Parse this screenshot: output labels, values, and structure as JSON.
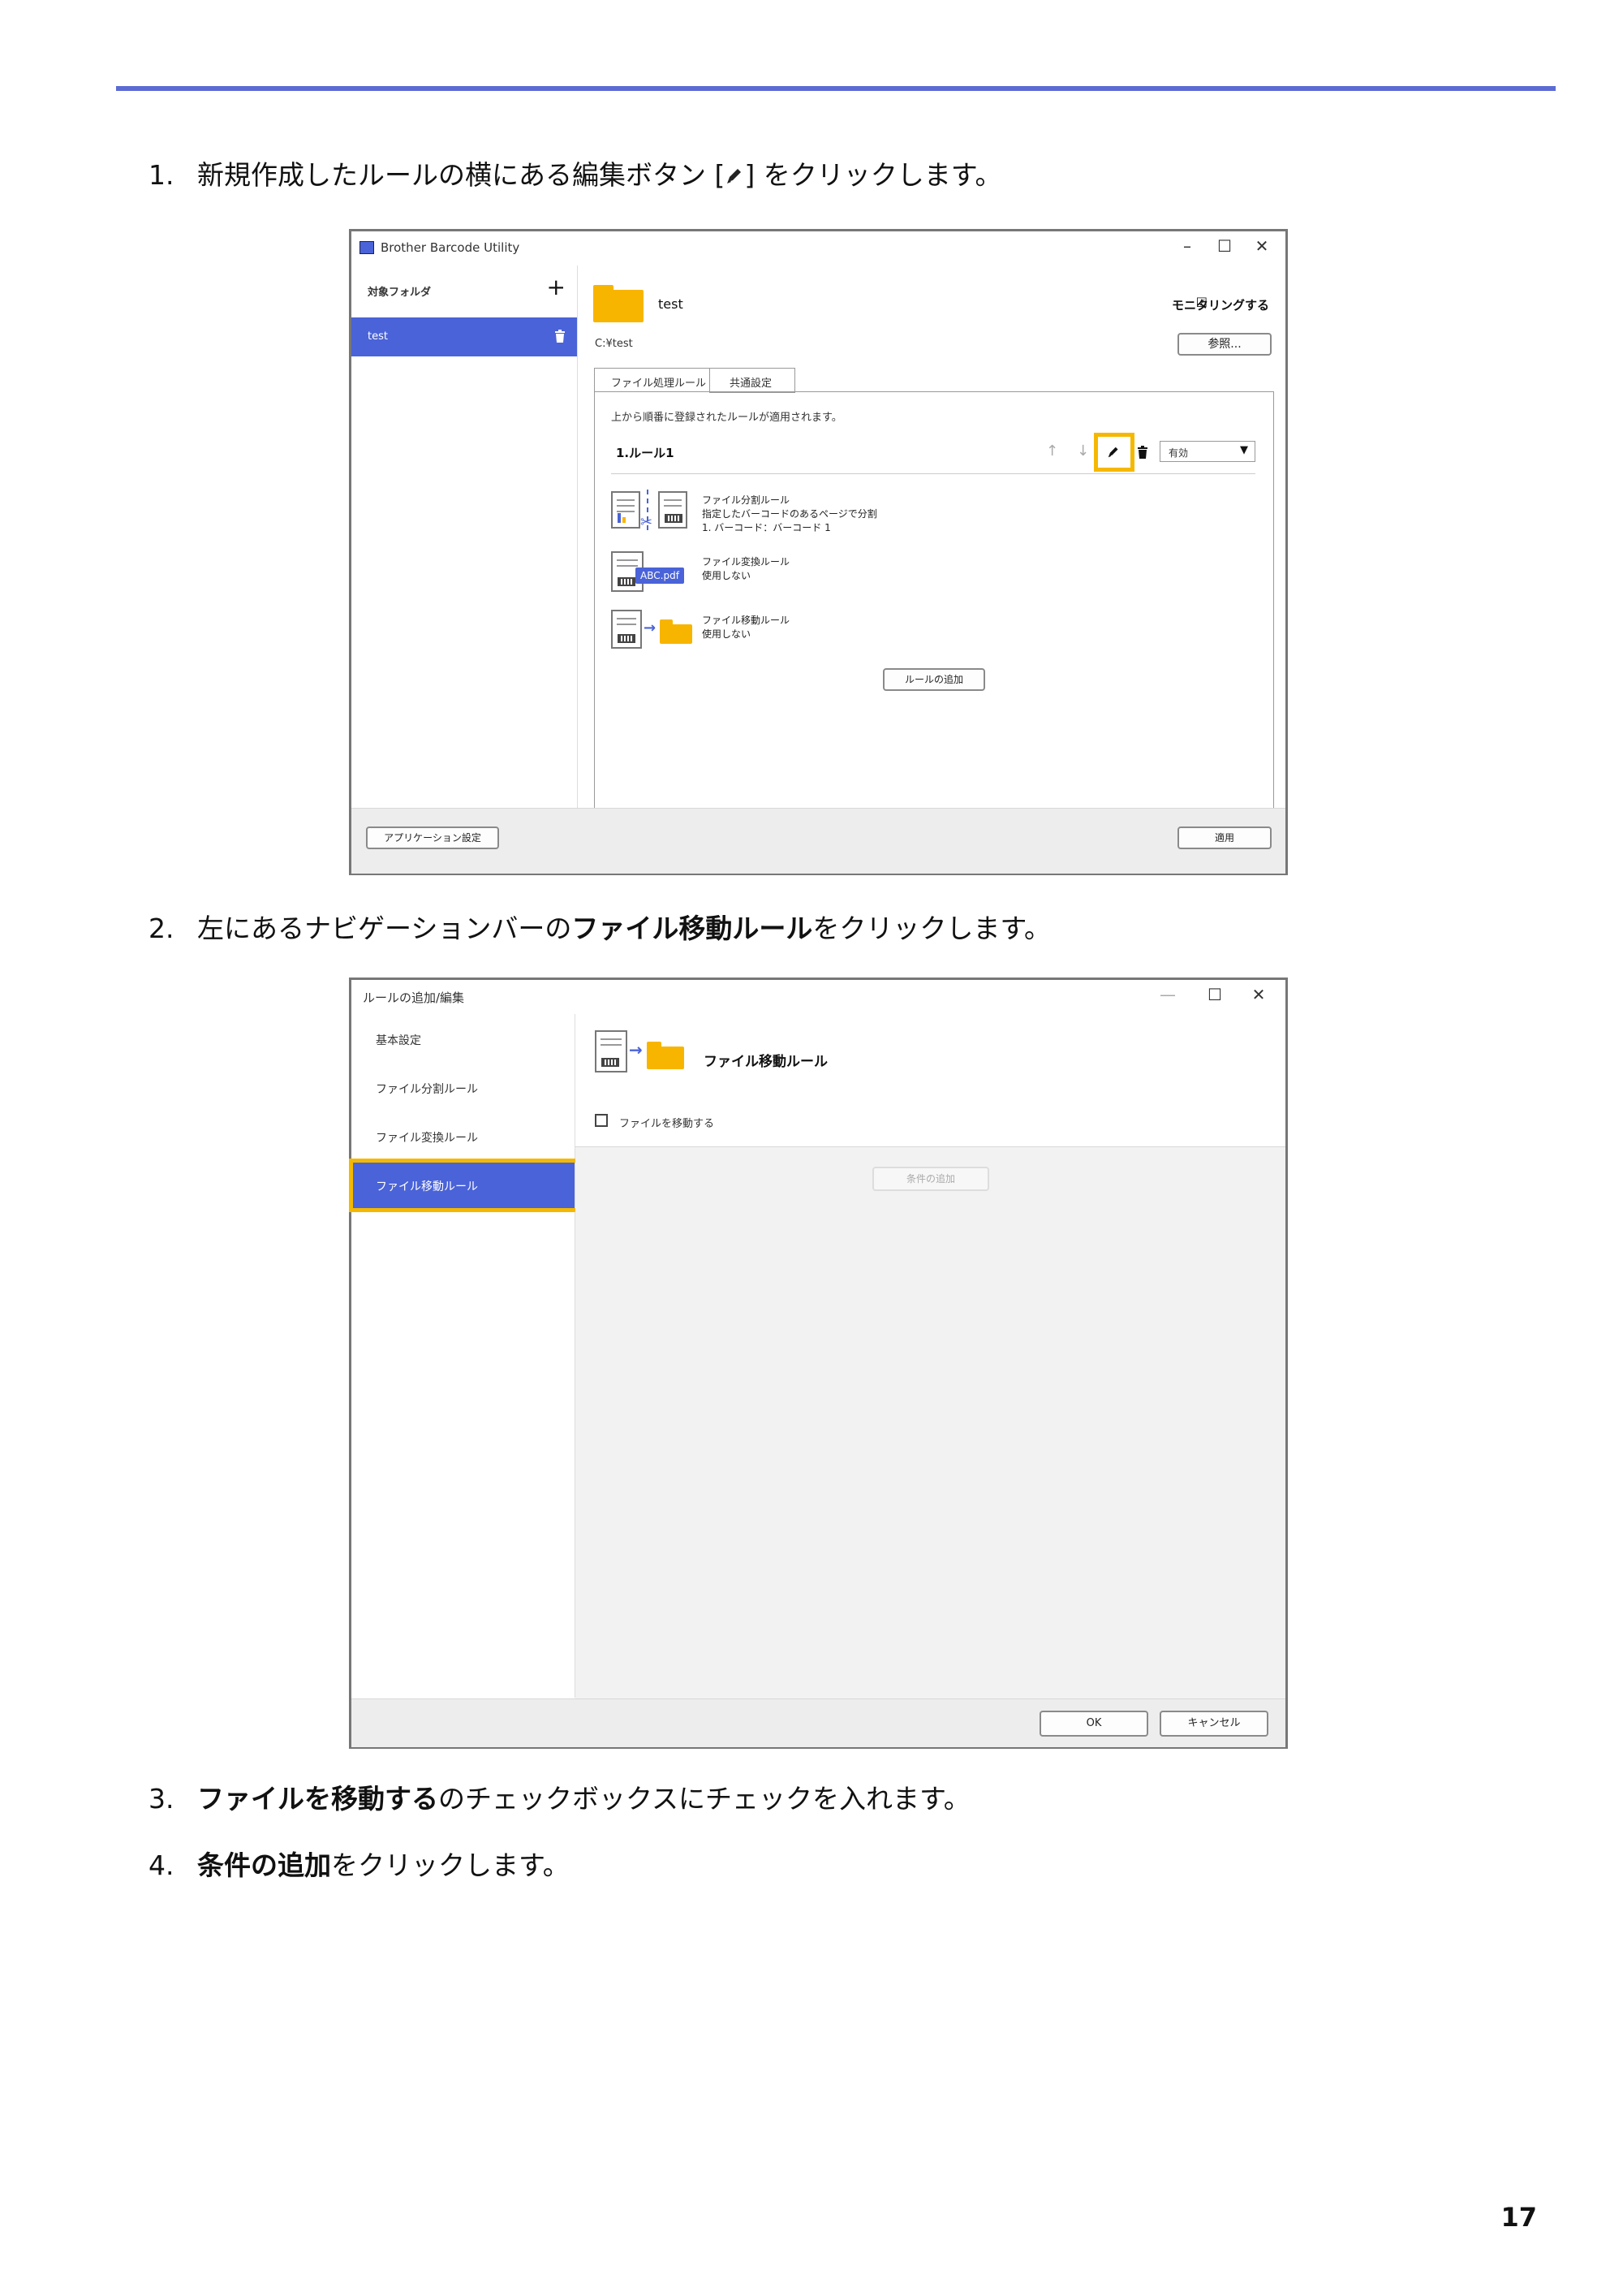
{
  "steps": [
    {
      "num": "1.",
      "before": "新規作成したルールの横にある編集ボタン [",
      "after": "] をクリックします。"
    },
    {
      "num": "2.",
      "before": "左にあるナビゲーションバーの",
      "bold": "ファイル移動ルール",
      "after": "をクリックします。"
    },
    {
      "num": "3.",
      "bold": "ファイルを移動する",
      "after": "のチェックボックスにチェックを入れます。"
    },
    {
      "num": "4.",
      "bold": "条件の追加",
      "after": "をクリックします。"
    }
  ],
  "page_number": "17",
  "window1": {
    "title": "Brother Barcode Utility",
    "sidebar_header": "対象フォルダ",
    "add_symbol": "+",
    "folder_item": "test",
    "folder_name": "test",
    "monitoring_label": "モニタリングする",
    "path": "C:¥test",
    "browse_button": "参照...",
    "tabs": [
      "ファイル処理ルール",
      "共通設定"
    ],
    "info_text": "上から順番に登録されたルールが適用されます。",
    "rule_title": "1.ルール1",
    "status_select": "有効",
    "split_rule": {
      "title": "ファイル分割ルール",
      "line1": "指定したバーコードのあるページで分割",
      "line2": "1. バーコード：バーコード 1"
    },
    "convert_rule": {
      "title": "ファイル変換ルール",
      "line1": "使用しない",
      "badge": "ABC.pdf"
    },
    "move_rule": {
      "title": "ファイル移動ルール",
      "line1": "使用しない"
    },
    "add_rule_button": "ルールの追加",
    "app_settings_button": "アプリケーション設定",
    "apply_button": "適用"
  },
  "window2": {
    "title": "ルールの追加/編集",
    "nav": [
      "基本設定",
      "ファイル分割ルール",
      "ファイル変換ルール",
      "ファイル移動ルール"
    ],
    "header": "ファイル移動ルール",
    "checkbox_label": "ファイルを移動する",
    "add_condition_button": "条件の追加",
    "ok_button": "OK",
    "cancel_button": "キャンセル"
  },
  "colors": {
    "accent": "#4a63d8",
    "highlight": "#f5b800",
    "folder": "#f7b500",
    "rule_line": "#5b6bd3"
  },
  "icons": [
    "pencil-icon",
    "trash-icon",
    "arrow-up-icon",
    "arrow-down-icon",
    "plus-icon",
    "folder-icon",
    "document-icon",
    "scissors-icon",
    "arrow-right-icon",
    "checkbox-icon",
    "minimize-icon",
    "maximize-icon",
    "close-icon",
    "dropdown-arrow-icon"
  ]
}
